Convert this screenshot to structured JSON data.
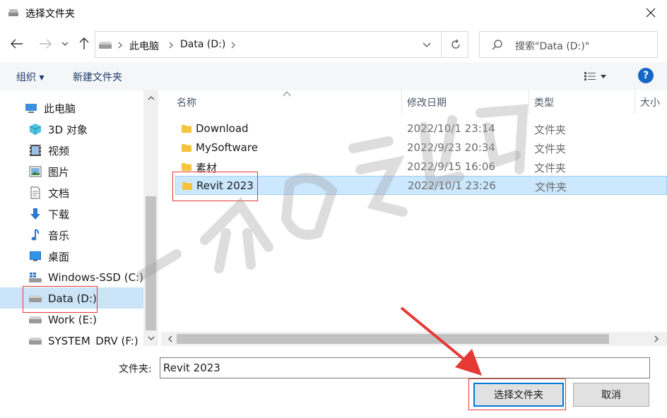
{
  "window": {
    "title": "选择文件夹"
  },
  "address": {
    "crumbs": [
      "此电脑",
      "Data (D:)"
    ]
  },
  "search": {
    "placeholder": "搜索\"Data (D:)\""
  },
  "toolbar": {
    "organize": "组织 ▾",
    "new_folder": "新建文件夹",
    "help": "?"
  },
  "nav": {
    "items": [
      {
        "label": "此电脑",
        "icon": "computer-icon"
      },
      {
        "label": "3D 对象",
        "icon": "cube-3d-icon"
      },
      {
        "label": "视频",
        "icon": "video-icon"
      },
      {
        "label": "图片",
        "icon": "picture-icon"
      },
      {
        "label": "文档",
        "icon": "document-icon"
      },
      {
        "label": "下载",
        "icon": "download-arrow-icon"
      },
      {
        "label": "音乐",
        "icon": "music-note-icon"
      },
      {
        "label": "桌面",
        "icon": "desktop-icon"
      },
      {
        "label": "Windows-SSD (C:)",
        "icon": "windows-drive-icon"
      },
      {
        "label": "Data (D:)",
        "icon": "drive-icon"
      },
      {
        "label": "Work (E:)",
        "icon": "drive-icon"
      },
      {
        "label": "SYSTEM_DRV (F:)",
        "icon": "drive-icon"
      }
    ],
    "selected_index": 9
  },
  "columns": {
    "name": "名称",
    "date": "修改日期",
    "type": "类型",
    "size": "大小"
  },
  "files": [
    {
      "name": "Download",
      "date": "2022/10/1 23:14",
      "type": "文件夹"
    },
    {
      "name": "MySoftware",
      "date": "2022/9/23 20:34",
      "type": "文件夹"
    },
    {
      "name": "素材",
      "date": "2022/9/15 16:06",
      "type": "文件夹"
    },
    {
      "name": "Revit 2023",
      "date": "2022/10/1 23:26",
      "type": "文件夹"
    }
  ],
  "selected_file_index": 3,
  "footer": {
    "folder_label": "文件夹:",
    "folder_value": "Revit 2023",
    "select_button": "选择文件夹",
    "cancel_button": "取消"
  },
  "colors": {
    "selection": "#cce8ff",
    "accent": "#0078d7",
    "annotation_red": "#e53935",
    "folder_yellow": "#f8c33a"
  }
}
